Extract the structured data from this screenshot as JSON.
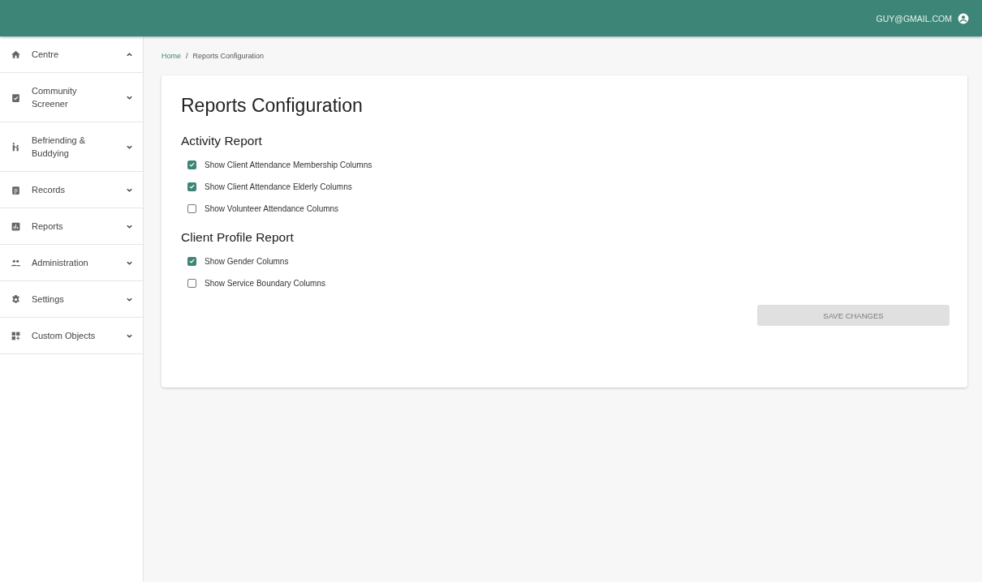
{
  "header": {
    "user": "GUY@GMAIL.COM"
  },
  "sidebar": {
    "items": [
      {
        "label": "Centre",
        "expanded": true
      },
      {
        "label": "Community Screener",
        "expanded": false
      },
      {
        "label": "Befriending & Buddying",
        "expanded": false
      },
      {
        "label": "Records",
        "expanded": false
      },
      {
        "label": "Reports",
        "expanded": false
      },
      {
        "label": "Administration",
        "expanded": false
      },
      {
        "label": "Settings",
        "expanded": false
      },
      {
        "label": "Custom Objects",
        "expanded": false
      }
    ]
  },
  "breadcrumb": {
    "separator": "/",
    "items": [
      "Home",
      "Reports Configuration"
    ]
  },
  "page": {
    "title": "Reports Configuration",
    "sections": [
      {
        "title": "Activity Report",
        "options": [
          {
            "label": "Show Client Attendance Membership Columns",
            "checked": true
          },
          {
            "label": "Show Client Attendance Elderly Columns",
            "checked": true
          },
          {
            "label": "Show Volunteer Attendance Columns",
            "checked": false
          }
        ]
      },
      {
        "title": "Client Profile Report",
        "options": [
          {
            "label": "Show Gender Columns",
            "checked": true
          },
          {
            "label": "Show Service Boundary Columns",
            "checked": false
          }
        ]
      }
    ],
    "save_button": {
      "label": "SAVE CHANGES",
      "disabled": true
    }
  }
}
